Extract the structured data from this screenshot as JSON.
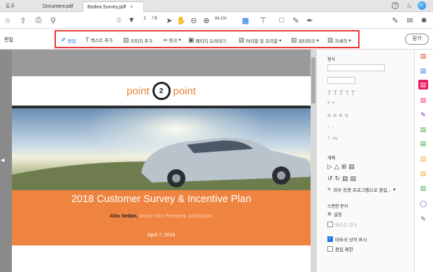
{
  "tabs": {
    "tools": "도구",
    "doc1": "Document.pdf",
    "doc2": "Bodea Survey.pdf",
    "close": "×"
  },
  "toolbar": {
    "page_current": "1",
    "page_total": "/ 6",
    "zoom": "84.1%"
  },
  "edit": {
    "label": "편집",
    "tools": [
      "편집",
      "텍스트 추가",
      "이미지 추가",
      "링크",
      "페이지 오려내기",
      "머리말 및 꼬리말",
      "워터마크",
      "자세히"
    ],
    "close_button": "닫기"
  },
  "document": {
    "logo_left": "point",
    "logo_center": "2",
    "logo_right": "point",
    "title": "2018 Customer Survey & Incentive Plan",
    "author_name": "Alex Sedan,",
    "author_role": " Senior Vice President, point2point",
    "date": "April 7, 2018"
  },
  "panel": {
    "format_label": "형식",
    "objects_label": "개체",
    "outer_edit": "외부 응용 프로그램으로 편집...",
    "scan_label": "스캔한 문서",
    "settings": "설정",
    "text_recognition": "텍스트 인식",
    "show_border": "테두리 상자 표시",
    "restrict_edit": "편집 제한"
  },
  "colors": {
    "accent": "#1a73e8",
    "highlight": "#e53935",
    "orange_band": "#ef8440"
  }
}
